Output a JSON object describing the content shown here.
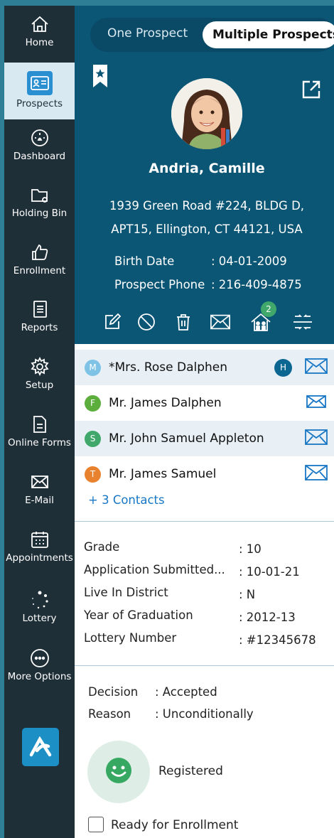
{
  "sidebar": {
    "items": [
      {
        "label": "Home",
        "icon": "home-icon"
      },
      {
        "label": "Prospects",
        "icon": "id-card-icon"
      },
      {
        "label": "Dashboard",
        "icon": "dashboard-icon"
      },
      {
        "label": "Holding Bin",
        "icon": "folder-icon"
      },
      {
        "label": "Enrollment",
        "icon": "thumbs-up-icon"
      },
      {
        "label": "Reports",
        "icon": "report-icon"
      },
      {
        "label": "Setup",
        "icon": "gear-icon"
      },
      {
        "label": "Online Forms",
        "icon": "form-icon"
      },
      {
        "label": "E-Mail",
        "icon": "mail-icon"
      },
      {
        "label": "Appointments",
        "icon": "calendar-icon"
      },
      {
        "label": "Lottery",
        "icon": "lottery-icon"
      },
      {
        "label": "More Options",
        "icon": "more-icon"
      }
    ]
  },
  "toggle": {
    "one": "One Prospect",
    "multiple": "Multiple Prospects"
  },
  "prospect": {
    "name": "Andria, Camille",
    "address_line1": "1939 Green Road #224, BLDG D,",
    "address_line2": "APT15, Ellington, CT 44121, USA",
    "birth_label": "Birth Date",
    "birth_value": ": 04-01-2009",
    "phone_label": "Prospect Phone",
    "phone_value": ": 216-409-4875",
    "household_count": "2"
  },
  "contacts": [
    {
      "initial": "M",
      "name": "*Mrs. Rose Dalphen",
      "color": "#7ec3e6",
      "extra": "H"
    },
    {
      "initial": "F",
      "name": "Mr. James Dalphen",
      "color": "#5cae3c"
    },
    {
      "initial": "S",
      "name": "Mr. John Samuel Appleton",
      "color": "#3fa86a"
    },
    {
      "initial": "T",
      "name": "Mr. James Samuel",
      "color": "#e8822e"
    }
  ],
  "more_contacts": "+ 3 Contacts",
  "details": [
    {
      "label": "Grade",
      "value": ": 10"
    },
    {
      "label": "Application Submitted...",
      "value": ": 10-01-21"
    },
    {
      "label": "Live In District",
      "value": ": N"
    },
    {
      "label": "Year of Graduation",
      "value": ": 2012-13"
    },
    {
      "label": "Lottery Number",
      "value": ": #12345678"
    }
  ],
  "decision": {
    "label": "Decision",
    "value": ": Accepted"
  },
  "reason": {
    "label": "Reason",
    "value": ": Unconditionally"
  },
  "status": "Registered",
  "ready_label": "Ready for Enrollment",
  "colors": {
    "header": "#0b5575",
    "sidebar": "#1f2f38",
    "accent": "#1877c4"
  }
}
